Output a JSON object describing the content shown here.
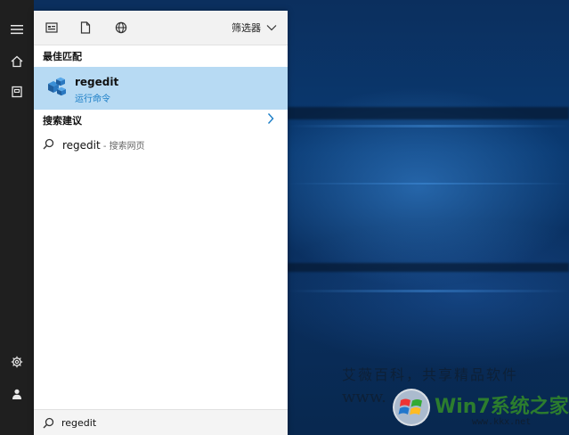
{
  "rail": {
    "items": [
      {
        "icon": "hamburger-icon"
      },
      {
        "icon": "home-icon"
      },
      {
        "icon": "document-icon"
      },
      {
        "icon": "settings-icon"
      },
      {
        "icon": "user-icon"
      }
    ]
  },
  "tabs": {
    "items": [
      {
        "icon": "apps-icon"
      },
      {
        "icon": "documents-icon"
      },
      {
        "icon": "web-icon"
      }
    ],
    "filter_label": "筛选器"
  },
  "results": {
    "best_match_heading": "最佳匹配",
    "best_match": {
      "title": "regedit",
      "subtitle": "运行命令",
      "icon": "registry-editor-icon"
    },
    "suggestions_heading": "搜索建议",
    "suggestions": [
      {
        "text": "regedit",
        "meta": " - 搜索网页",
        "icon": "search-icon"
      }
    ]
  },
  "search": {
    "value": "regedit",
    "icon": "search-icon"
  },
  "watermark": {
    "line1": "艾薇百科，共享精品软件",
    "www_prefix": "www.",
    "brand": "Win7系统之家",
    "url": "www.kkx.net"
  },
  "colors": {
    "highlight": "#b7daf3",
    "accent_text": "#1a7dc6",
    "rail": "#1f1f1f",
    "desktop": "#0a3a72"
  }
}
